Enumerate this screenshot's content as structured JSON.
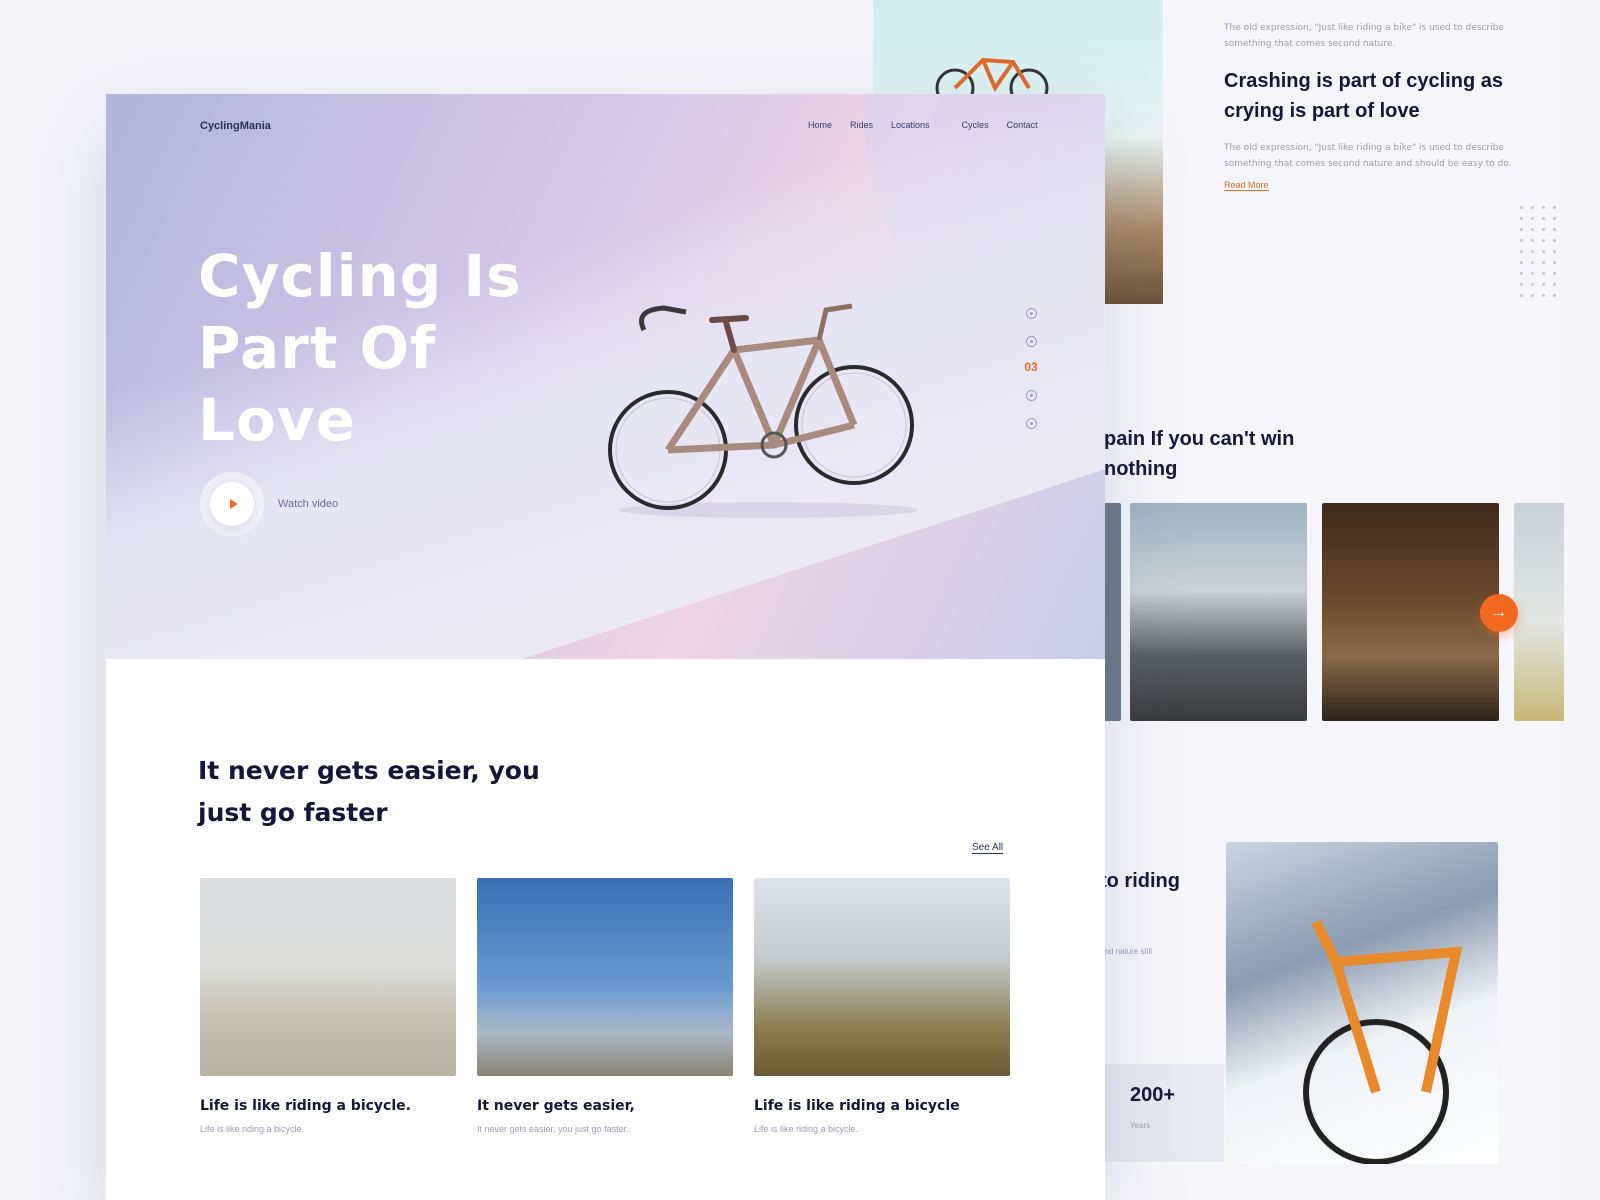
{
  "side_article": {
    "meta_top": "The old expression, \"Just like riding a bike\" is used to describe something that comes second nature.",
    "title": "Crashing is part of cycling as crying is part of love",
    "excerpt": "The old expression, \"Just like riding a bike\" is used to describe something that comes second nature and should be easy to do.",
    "read_more": "Read More"
  },
  "side_quote": {
    "title": "pain If you can't win nothing"
  },
  "side_feature": {
    "title": "to riding",
    "small": "and nature still",
    "stat_number": "200+",
    "stat_label": "Years"
  },
  "nav": {
    "logo": "CyclingMania",
    "links": [
      "Home",
      "Rides",
      "Locations",
      "Cycles",
      "Contact"
    ]
  },
  "hero": {
    "title_line1a": "Cycling",
    "title_line1b": "Is",
    "title_line2a": "Part",
    "title_line2b": "Of",
    "title_line3": "Love",
    "watch_label": "Watch video",
    "current_slide": "03"
  },
  "blog": {
    "heading_line1": "It never gets easier, you",
    "heading_line2": "just go faster",
    "see_all": "See All",
    "cards": [
      {
        "title": "Life is like riding a bicycle.",
        "excerpt": "Life is like riding a bicycle."
      },
      {
        "title": "It never gets easier,",
        "excerpt": "It never gets easier, you just go faster."
      },
      {
        "title": "Life is like riding a bicycle",
        "excerpt": "Life is like riding a bicycle."
      }
    ]
  },
  "colors": {
    "accent": "#f26a21",
    "text_dark": "#14163a",
    "muted": "#9c9eb3"
  },
  "icons": {
    "play": "play-icon",
    "next": "arrow-right-icon",
    "pager_dot": "circle-dot-icon"
  }
}
